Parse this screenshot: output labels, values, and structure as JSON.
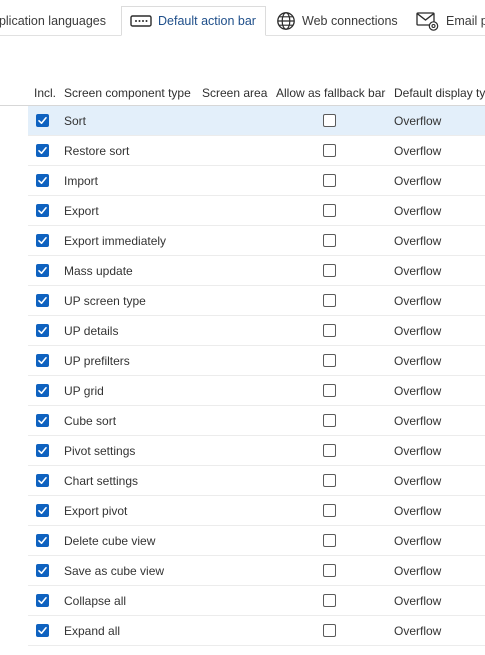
{
  "tabs": [
    {
      "label": "pplication languages",
      "active": false,
      "icon": "none"
    },
    {
      "label": "Default action bar",
      "active": true,
      "icon": "toolbar-icon"
    },
    {
      "label": "Web connections",
      "active": false,
      "icon": "globe-icon"
    },
    {
      "label": "Email pr",
      "active": false,
      "icon": "email-settings-icon"
    }
  ],
  "grid": {
    "columns": {
      "incl": "Incl.",
      "component": "Screen component type",
      "area": "Screen area",
      "fallback": "Allow as fallback bar",
      "display": "Default display ty"
    },
    "rows": [
      {
        "incl": true,
        "component": "Sort",
        "area": "",
        "fallback": false,
        "display": "Overflow",
        "selected": true
      },
      {
        "incl": true,
        "component": "Restore sort",
        "area": "",
        "fallback": false,
        "display": "Overflow",
        "selected": false
      },
      {
        "incl": true,
        "component": "Import",
        "area": "",
        "fallback": false,
        "display": "Overflow",
        "selected": false
      },
      {
        "incl": true,
        "component": "Export",
        "area": "",
        "fallback": false,
        "display": "Overflow",
        "selected": false
      },
      {
        "incl": true,
        "component": "Export immediately",
        "area": "",
        "fallback": false,
        "display": "Overflow",
        "selected": false
      },
      {
        "incl": true,
        "component": "Mass update",
        "area": "",
        "fallback": false,
        "display": "Overflow",
        "selected": false
      },
      {
        "incl": true,
        "component": "UP screen type",
        "area": "",
        "fallback": false,
        "display": "Overflow",
        "selected": false
      },
      {
        "incl": true,
        "component": "UP details",
        "area": "",
        "fallback": false,
        "display": "Overflow",
        "selected": false
      },
      {
        "incl": true,
        "component": "UP prefilters",
        "area": "",
        "fallback": false,
        "display": "Overflow",
        "selected": false
      },
      {
        "incl": true,
        "component": "UP grid",
        "area": "",
        "fallback": false,
        "display": "Overflow",
        "selected": false
      },
      {
        "incl": true,
        "component": "Cube sort",
        "area": "",
        "fallback": false,
        "display": "Overflow",
        "selected": false
      },
      {
        "incl": true,
        "component": "Pivot settings",
        "area": "",
        "fallback": false,
        "display": "Overflow",
        "selected": false
      },
      {
        "incl": true,
        "component": "Chart settings",
        "area": "",
        "fallback": false,
        "display": "Overflow",
        "selected": false
      },
      {
        "incl": true,
        "component": "Export pivot",
        "area": "",
        "fallback": false,
        "display": "Overflow",
        "selected": false
      },
      {
        "incl": true,
        "component": "Delete cube view",
        "area": "",
        "fallback": false,
        "display": "Overflow",
        "selected": false
      },
      {
        "incl": true,
        "component": "Save as cube view",
        "area": "",
        "fallback": false,
        "display": "Overflow",
        "selected": false
      },
      {
        "incl": true,
        "component": "Collapse all",
        "area": "",
        "fallback": false,
        "display": "Overflow",
        "selected": false
      },
      {
        "incl": true,
        "component": "Expand all",
        "area": "",
        "fallback": false,
        "display": "Overflow",
        "selected": false
      }
    ]
  },
  "colors": {
    "accent": "#0f62c0",
    "selected_row": "#e3effa",
    "active_tab_text": "#1f4f8a"
  }
}
